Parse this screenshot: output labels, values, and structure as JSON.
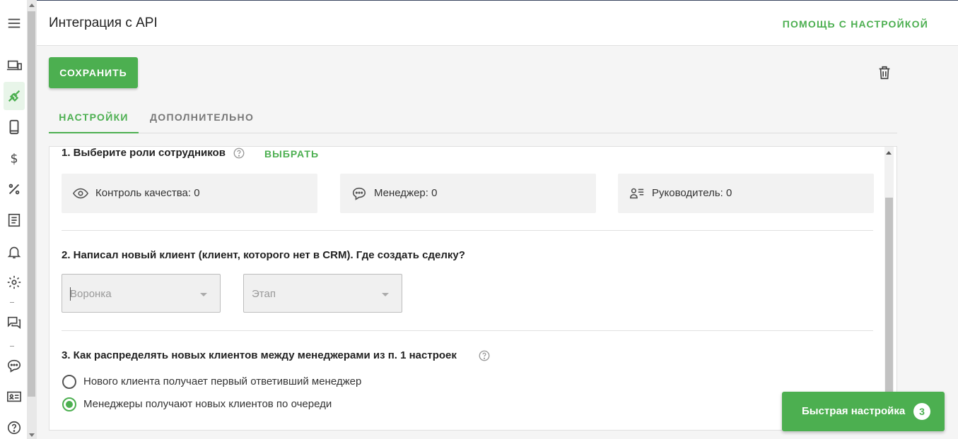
{
  "header": {
    "title": "Интеграция с API",
    "help_link": "ПОМОЩЬ С НАСТРОЙКОЙ"
  },
  "sidebar": {
    "icons": [
      "menu-icon",
      "devices-icon",
      "plug-icon",
      "phone-icon",
      "dollar-icon",
      "percent-icon",
      "document-icon",
      "bell-icon",
      "gear-icon",
      "chat-forum-icon",
      "chat-bubble-icon",
      "contact-card-icon",
      "help-icon"
    ],
    "active": "plug-icon"
  },
  "toolbar": {
    "save_label": "СОХРАНИТЬ"
  },
  "tabs": [
    {
      "label": "НАСТРОЙКИ",
      "active": true
    },
    {
      "label": "ДОПОЛНИТЕЛЬНО",
      "active": false
    }
  ],
  "section1": {
    "title": "1. Выберите роли сотрудников",
    "choose_label": "ВЫБРАТЬ",
    "roles": [
      {
        "label": "Контроль качества: 0",
        "icon": "eye-icon"
      },
      {
        "label": "Менеджер: 0",
        "icon": "chat-dots-icon"
      },
      {
        "label": "Руководитель: 0",
        "icon": "person-list-icon"
      }
    ]
  },
  "section2": {
    "title": "2. Написал новый клиент (клиент, которого нет в CRM). Где создать сделку?",
    "funnel_placeholder": "Воронка",
    "stage_placeholder": "Этап"
  },
  "section3": {
    "title": "3. Как распределять новых клиентов между менеджерами из п. 1 настроек",
    "options": [
      {
        "label": "Нового клиента получает первый ответивший менеджер",
        "checked": false
      },
      {
        "label": "Менеджеры получают новых клиентов по очереди",
        "checked": true
      }
    ]
  },
  "quick_setup": {
    "label": "Быстрая настройка",
    "badge": "3"
  },
  "colors": {
    "accent": "#4caf50"
  }
}
